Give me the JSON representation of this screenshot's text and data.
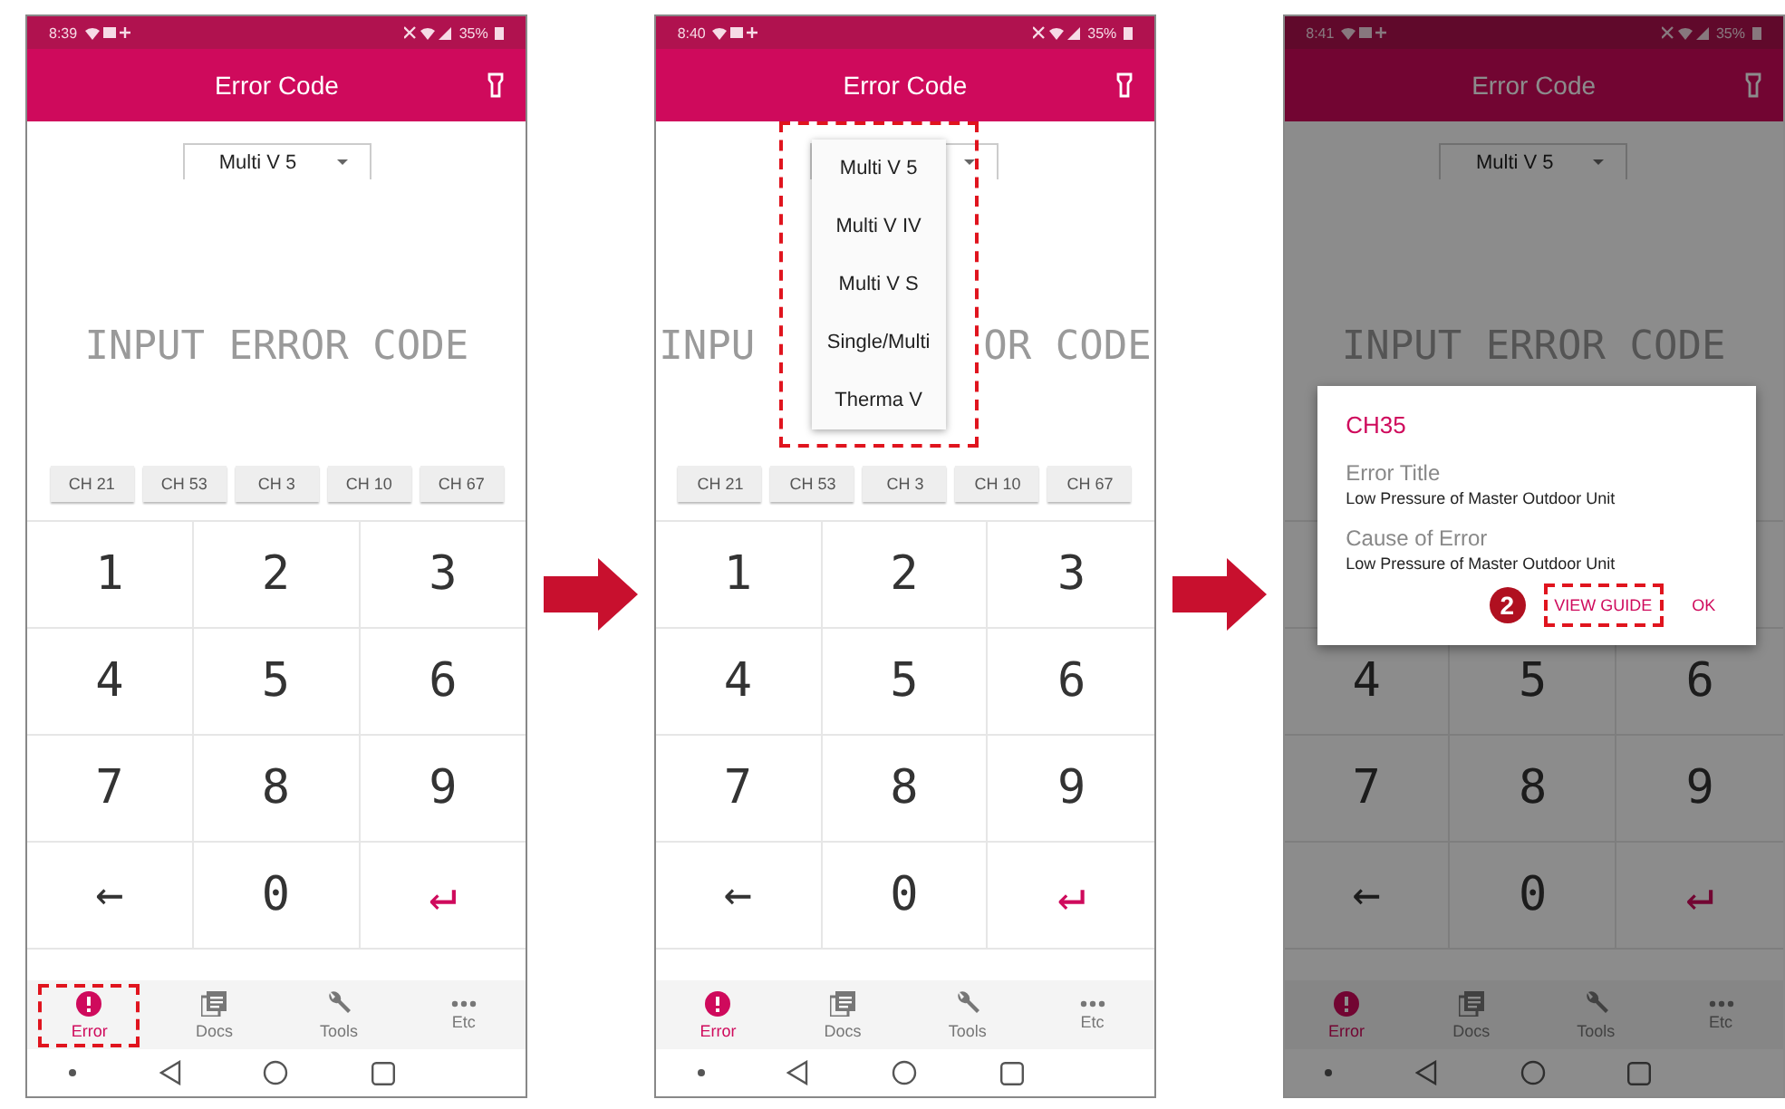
{
  "phones": [
    {
      "status": {
        "time": "8:39",
        "battery": "35%"
      },
      "title": "Error Code",
      "dimmed": false,
      "selector": {
        "value": "Multi V 5"
      },
      "display": [
        "INPUT ERROR CODE"
      ],
      "chips": [
        "CH 21",
        "CH 53",
        "CH 3",
        "CH 10",
        "CH 67"
      ],
      "key_rows": [
        [
          {
            "label": "1",
            "kind": "digit"
          },
          {
            "label": "2",
            "kind": "digit"
          },
          {
            "label": "3",
            "kind": "digit"
          }
        ],
        [
          {
            "label": "4",
            "kind": "digit"
          },
          {
            "label": "5",
            "kind": "digit"
          },
          {
            "label": "6",
            "kind": "digit"
          }
        ],
        [
          {
            "label": "7",
            "kind": "digit"
          },
          {
            "label": "8",
            "kind": "digit"
          },
          {
            "label": "9",
            "kind": "digit"
          }
        ],
        [
          {
            "label": "←",
            "kind": "back"
          },
          {
            "label": "0",
            "kind": "digit"
          },
          {
            "label": "↵",
            "kind": "enter"
          }
        ]
      ],
      "nav": [
        {
          "label": "Error",
          "kind": "error",
          "selected": true,
          "highlighted": true
        },
        {
          "label": "Docs",
          "kind": "docs",
          "selected": false,
          "highlighted": false
        },
        {
          "label": "Tools",
          "kind": "tools",
          "selected": false,
          "highlighted": false
        },
        {
          "label": "Etc",
          "kind": "more",
          "selected": false,
          "highlighted": false
        }
      ]
    },
    {
      "status": {
        "time": "8:40",
        "battery": "35%"
      },
      "title": "Error Code",
      "dimmed": false,
      "display": [
        "INPU",
        "OR CODE"
      ],
      "dropdown": {
        "highlighted": true,
        "items": [
          "Multi V 5",
          "Multi V IV",
          "Multi V S",
          "Single/Multi",
          "Therma V"
        ]
      },
      "chips": [
        "CH 21",
        "CH 53",
        "CH 3",
        "CH 10",
        "CH 67"
      ],
      "key_rows": [
        [
          {
            "label": "1",
            "kind": "digit"
          },
          {
            "label": "2",
            "kind": "digit"
          },
          {
            "label": "3",
            "kind": "digit"
          }
        ],
        [
          {
            "label": "4",
            "kind": "digit"
          },
          {
            "label": "5",
            "kind": "digit"
          },
          {
            "label": "6",
            "kind": "digit"
          }
        ],
        [
          {
            "label": "7",
            "kind": "digit"
          },
          {
            "label": "8",
            "kind": "digit"
          },
          {
            "label": "9",
            "kind": "digit"
          }
        ],
        [
          {
            "label": "←",
            "kind": "back"
          },
          {
            "label": "0",
            "kind": "digit"
          },
          {
            "label": "↵",
            "kind": "enter"
          }
        ]
      ],
      "nav": [
        {
          "label": "Error",
          "kind": "error",
          "selected": true,
          "highlighted": false
        },
        {
          "label": "Docs",
          "kind": "docs",
          "selected": false,
          "highlighted": false
        },
        {
          "label": "Tools",
          "kind": "tools",
          "selected": false,
          "highlighted": false
        },
        {
          "label": "Etc",
          "kind": "more",
          "selected": false,
          "highlighted": false
        }
      ]
    },
    {
      "status": {
        "time": "8:41",
        "battery": "35%"
      },
      "title": "Error Code",
      "dimmed": true,
      "selector": {
        "value": "Multi V 5"
      },
      "display": [
        "INPUT ERROR CODE"
      ],
      "dialog": {
        "code": "CH35",
        "fields": [
          {
            "label": "Error Title",
            "value": "Low Pressure of Master Outdoor Unit"
          },
          {
            "label": "Cause of Error",
            "value": "Low Pressure of Master Outdoor Unit"
          }
        ],
        "buttons": [
          {
            "label": "VIEW GUIDE",
            "highlighted": true,
            "callout": "2"
          },
          {
            "label": "OK",
            "highlighted": false
          }
        ]
      },
      "key_rows": [
        [
          {
            "label": "4",
            "kind": "digit"
          },
          {
            "label": "5",
            "kind": "digit"
          },
          {
            "label": "6",
            "kind": "digit"
          }
        ],
        [
          {
            "label": "7",
            "kind": "digit"
          },
          {
            "label": "8",
            "kind": "digit"
          },
          {
            "label": "9",
            "kind": "digit"
          }
        ],
        [
          {
            "label": "←",
            "kind": "back"
          },
          {
            "label": "0",
            "kind": "digit"
          },
          {
            "label": "↵",
            "kind": "enter"
          }
        ]
      ],
      "nav": [
        {
          "label": "Error",
          "kind": "error",
          "selected": true,
          "highlighted": false
        },
        {
          "label": "Docs",
          "kind": "docs",
          "selected": false,
          "highlighted": false
        },
        {
          "label": "Tools",
          "kind": "tools",
          "selected": false,
          "highlighted": false
        },
        {
          "label": "Etc",
          "kind": "more",
          "selected": false,
          "highlighted": false
        }
      ]
    }
  ]
}
